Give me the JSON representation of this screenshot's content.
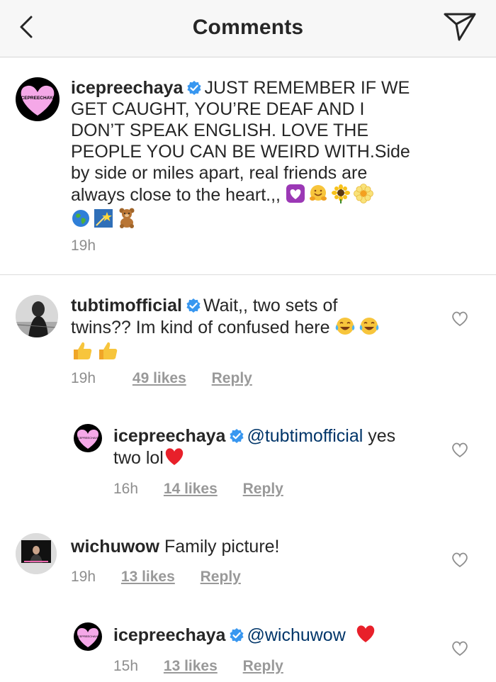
{
  "header": {
    "title": "Comments"
  },
  "caption": {
    "avatar_text": "ICEPREECHAYA",
    "username": "icepreechaya",
    "lines": [
      "JUST REMEMBER IF WE",
      "GET CAUGHT, YOU’RE DEAF AND I",
      "DON’T SPEAK ENGLISH. LOVE THE",
      "PEOPLE YOU CAN BE WEIRD WITH.Side",
      "by side or miles apart, real friends are",
      "always close to the heart.,,"
    ],
    "emojis_line1": [
      "purple-heart-emoji",
      "hugging-face-emoji",
      "sunflower-emoji",
      "blossom-emoji"
    ],
    "emojis_line2": [
      "globe-emoji",
      "shooting-star-emoji",
      "teddy-bear-emoji"
    ],
    "time": "19h"
  },
  "comments": [
    {
      "username": "tubtimofficial",
      "line1": "Wait,, two sets of",
      "line2": "twins?? Im kind of confused here",
      "time": "19h",
      "likes": "49 likes",
      "reply": "Reply"
    },
    {
      "username": "icepreechaya",
      "avatar_text": "ICEPREECHAYA",
      "mention": "@tubtimofficial",
      "after_mention": " yes",
      "line2": "two lol",
      "time": "16h",
      "likes": "14 likes",
      "reply": "Reply"
    },
    {
      "username": "wichuwow",
      "text": "Family picture!",
      "time": "19h",
      "likes": "13 likes",
      "reply": "Reply"
    },
    {
      "username": "icepreechaya",
      "avatar_text": "ICEPREECHAYA",
      "mention": "@wichuwow",
      "time": "15h",
      "likes": "13 likes",
      "reply": "Reply"
    }
  ],
  "colors": {
    "verified": "#3897f0",
    "heart": "#ed4956",
    "mention": "#003569",
    "pink_heart": "#f5a8e8"
  }
}
